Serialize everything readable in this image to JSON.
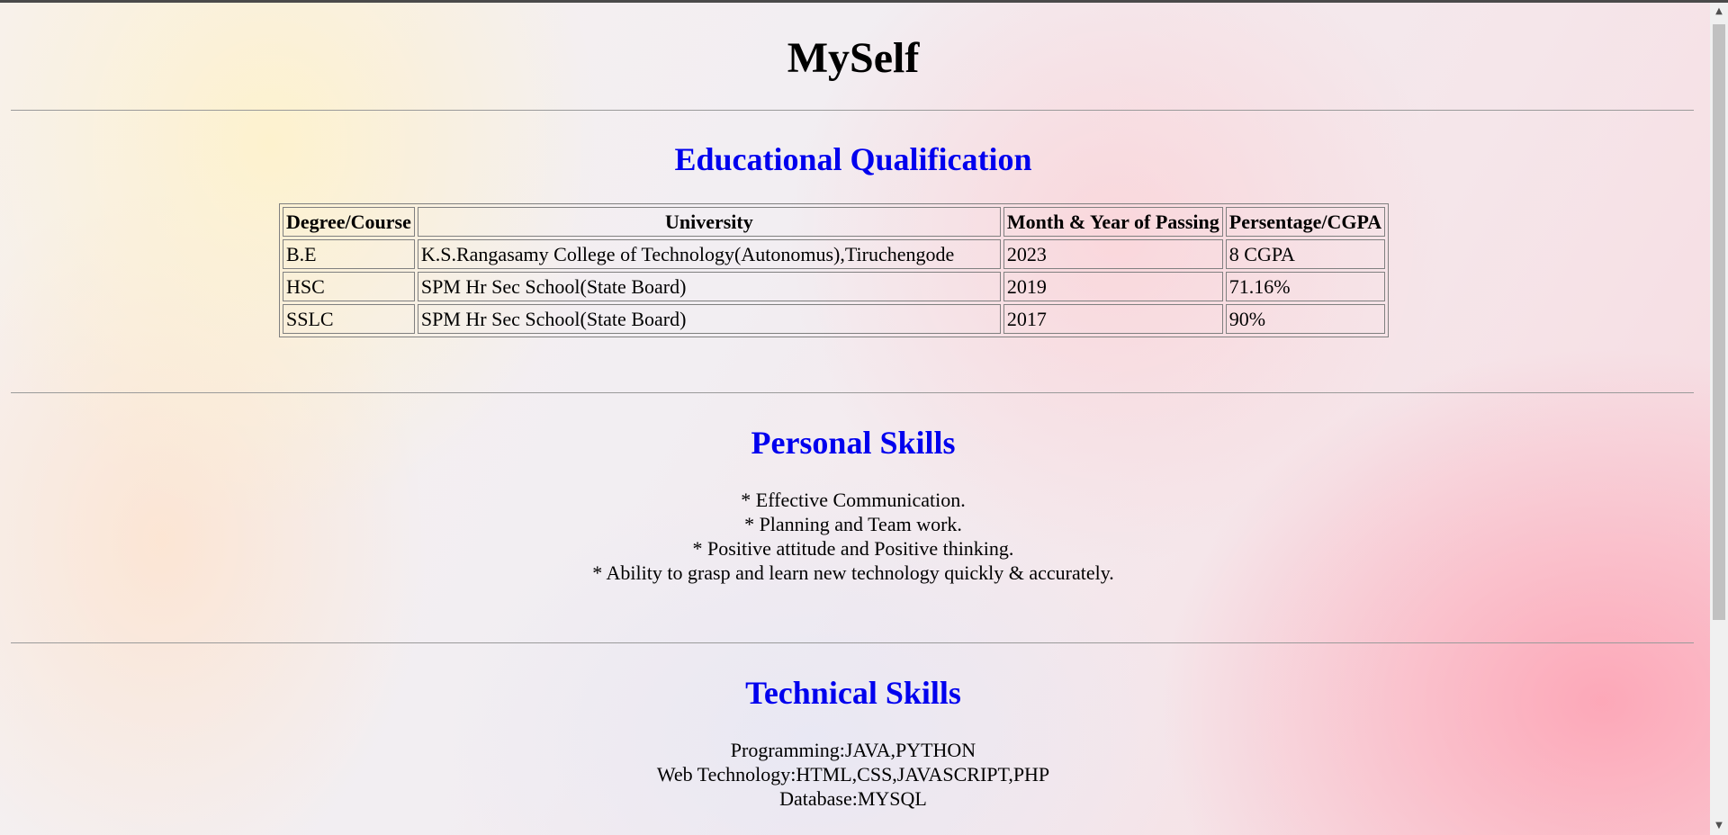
{
  "page_title": "MySelf",
  "education": {
    "heading": "Educational Qualification",
    "columns": [
      "Degree/Course",
      "University",
      "Month & Year of Passing",
      "Persentage/CGPA"
    ],
    "rows": [
      [
        "B.E",
        "K.S.Rangasamy College of Technology(Autonomus),Tiruchengode",
        "2023",
        "8 CGPA"
      ],
      [
        "HSC",
        "SPM Hr Sec School(State Board)",
        "2019",
        "71.16%"
      ],
      [
        "SSLC",
        "SPM Hr Sec School(State Board)",
        "2017",
        "90%"
      ]
    ]
  },
  "personal_skills": {
    "heading": "Personal Skills",
    "items": [
      "* Effective Communication.",
      "* Planning and Team work.",
      "* Positive attitude and Positive thinking.",
      "* Ability to grasp and learn new technology quickly & accurately."
    ]
  },
  "technical_skills": {
    "heading": "Technical Skills",
    "items": [
      "Programming:JAVA,PYTHON",
      "Web Technology:HTML,CSS,JAVASCRIPT,PHP",
      "Database:MYSQL"
    ]
  },
  "scrollbar": {
    "up_icon": "▲",
    "down_icon": "▼"
  }
}
